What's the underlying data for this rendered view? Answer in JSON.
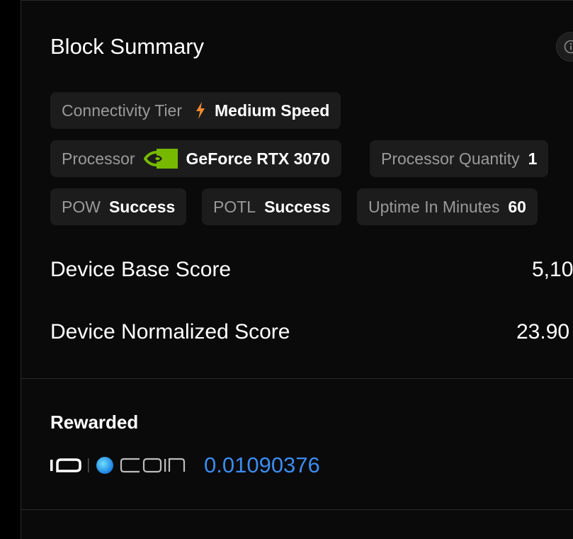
{
  "colors": {
    "background": "#0a0a0a",
    "chip_background": "#1c1c1c",
    "label_gray": "#9a9a9a",
    "accent_blue": "#3b8cf0",
    "bolt_orange": "#f08a30",
    "nvidia_green": "#76b900"
  },
  "block_summary": {
    "title": "Block Summary",
    "info_icon": "info-circle-icon"
  },
  "chips": {
    "connectivity": {
      "label": "Connectivity Tier",
      "icon": "lightning-bolt-icon",
      "value": "Medium Speed"
    },
    "processor": {
      "label": "Processor",
      "icon": "nvidia-logo-icon",
      "value": "GeForce RTX 3070"
    },
    "processor_quantity": {
      "label": "Processor Quantity",
      "value": "1"
    },
    "pow": {
      "label": "POW",
      "value": "Success"
    },
    "potl": {
      "label": "POTL",
      "value": "Success"
    },
    "uptime": {
      "label": "Uptime In Minutes",
      "value": "60"
    }
  },
  "scores": {
    "base": {
      "label": "Device Base Score",
      "value": "5,10"
    },
    "normalized": {
      "label": "Device Normalized Score",
      "value": "23.90"
    }
  },
  "rewarded": {
    "heading": "Rewarded",
    "logo": "io-coin-logo",
    "amount": "0.01090376"
  }
}
